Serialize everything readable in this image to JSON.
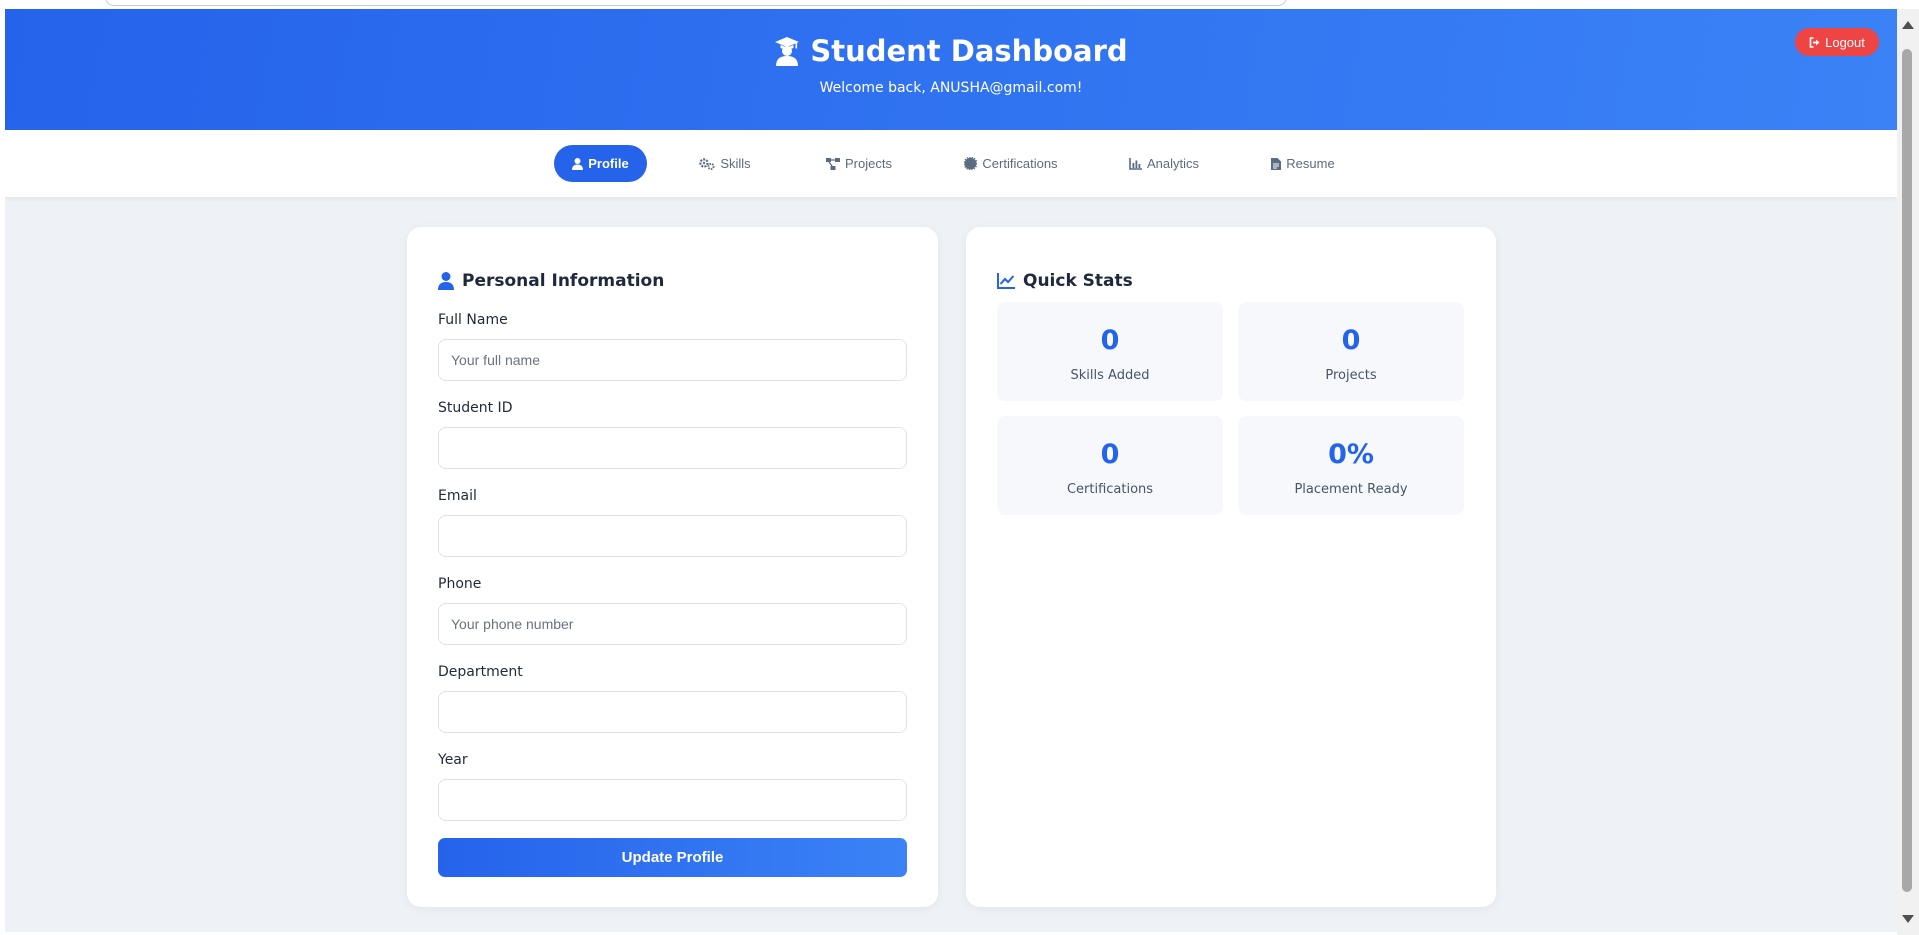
{
  "header": {
    "title": "Student Dashboard",
    "subtitle": "Welcome back, ANUSHA@gmail.com!",
    "logout_label": "Logout",
    "title_icon": "graduation-cap-icon"
  },
  "nav": {
    "tabs": [
      {
        "label": "Profile",
        "icon": "user-icon",
        "active": true
      },
      {
        "label": "Skills",
        "icon": "cogs-icon",
        "active": false
      },
      {
        "label": "Projects",
        "icon": "project-diagram-icon",
        "active": false
      },
      {
        "label": "Certifications",
        "icon": "certificate-icon",
        "active": false
      },
      {
        "label": "Analytics",
        "icon": "chart-line-icon",
        "active": false
      },
      {
        "label": "Resume",
        "icon": "file-icon",
        "active": false
      }
    ]
  },
  "profile": {
    "title": "Personal Information",
    "fields": [
      {
        "label": "Full Name",
        "value": "",
        "placeholder": "Your full name"
      },
      {
        "label": "Student ID",
        "value": "",
        "placeholder": ""
      },
      {
        "label": "Email",
        "value": "",
        "placeholder": ""
      },
      {
        "label": "Phone",
        "value": "",
        "placeholder": "Your phone number"
      },
      {
        "label": "Department",
        "value": "",
        "placeholder": ""
      },
      {
        "label": "Year",
        "value": "",
        "placeholder": ""
      }
    ],
    "submit_label": "Update Profile"
  },
  "stats": {
    "title": "Quick Stats",
    "items": [
      {
        "value": "0",
        "label": "Skills Added"
      },
      {
        "value": "0",
        "label": "Projects"
      },
      {
        "value": "0",
        "label": "Certifications"
      },
      {
        "value": "0%",
        "label": "Placement Ready"
      }
    ]
  },
  "colors": {
    "primary": "#2563eb",
    "primary_light": "#3b82f6",
    "danger": "#ef4444",
    "background": "#eef2f7"
  }
}
